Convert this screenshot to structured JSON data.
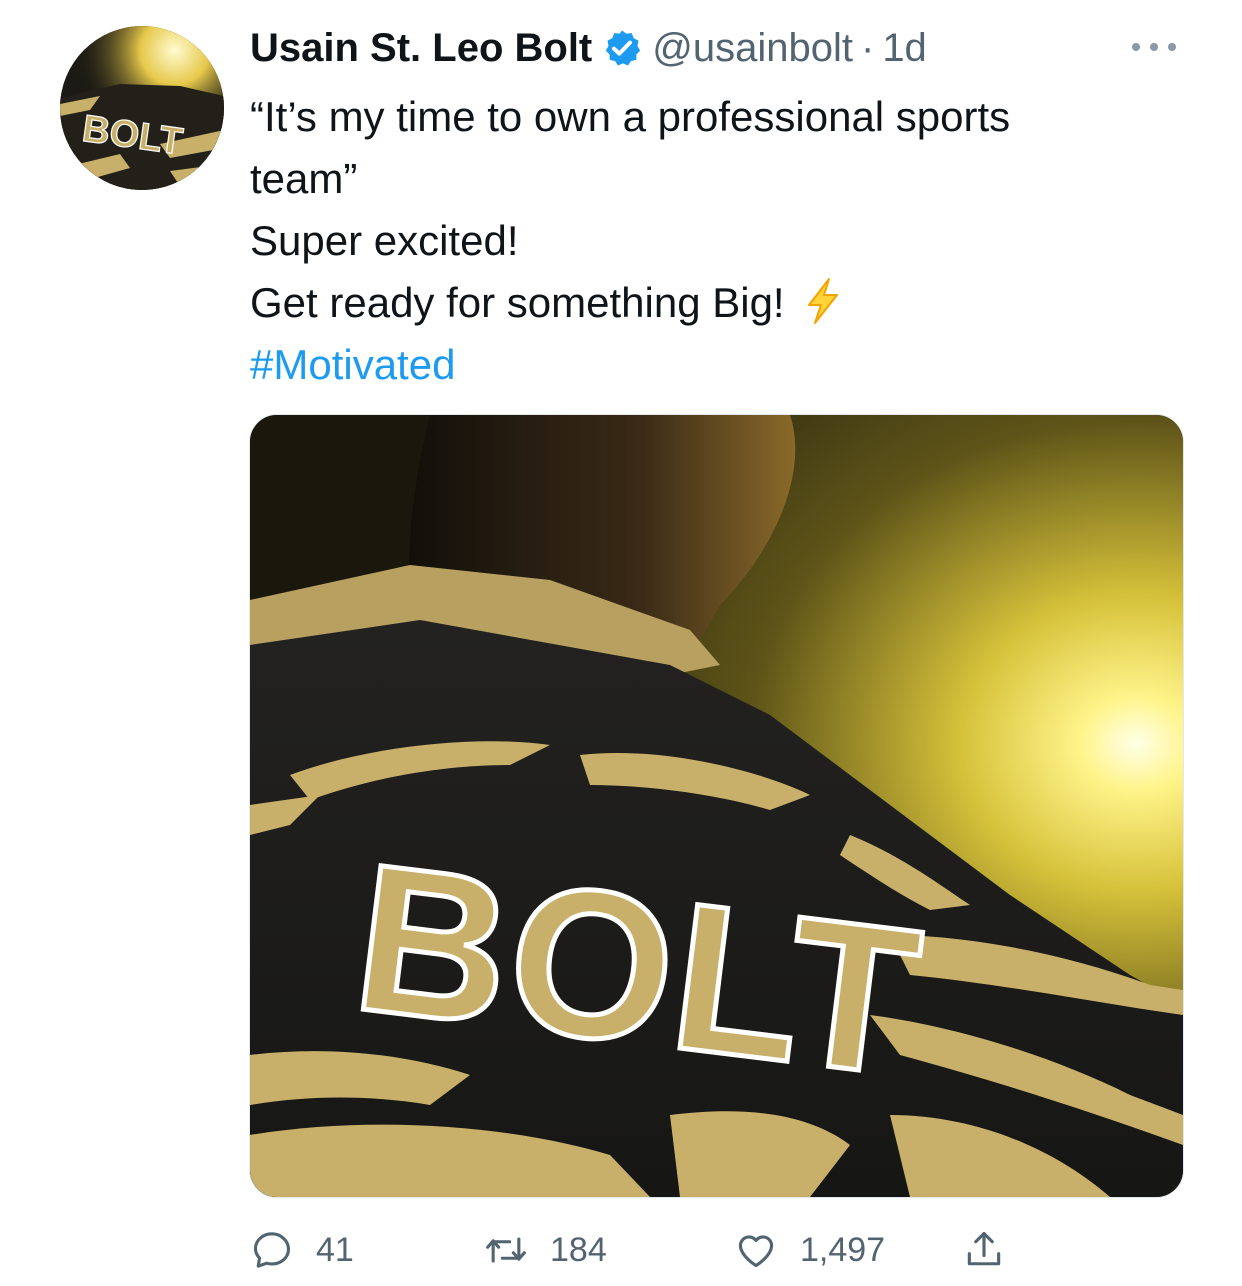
{
  "tweet": {
    "display_name": "Usain St. Leo Bolt",
    "handle": "@usainbolt",
    "separator": "·",
    "timestamp": "1d",
    "text_lines": [
      "“It’s my time to own a professional sports",
      "team”",
      "Super excited!",
      "Get ready for something Big!"
    ],
    "emoji": "high-voltage-emoji",
    "hashtag": "#Motivated"
  },
  "avatar": {
    "jersey_text": "BOLT"
  },
  "media": {
    "jersey_text": "BOLT"
  },
  "actions": {
    "replies": "41",
    "retweets": "184",
    "likes": "1,497"
  },
  "colors": {
    "link_blue": "#1d9bf0",
    "secondary_text": "#536471",
    "verified_blue": "#1d9bf0",
    "jersey_gold": "#c9b06a"
  }
}
